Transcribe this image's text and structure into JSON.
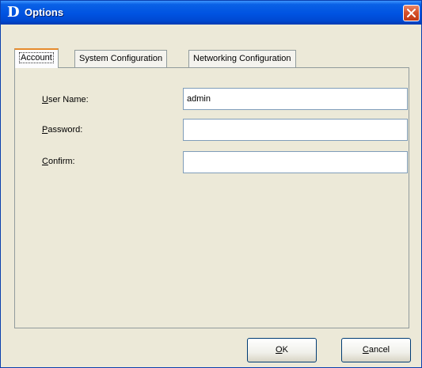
{
  "window": {
    "logo_text": "D",
    "title": "Options",
    "close_icon": "close-icon"
  },
  "tabs": [
    {
      "label": "Account",
      "active": true
    },
    {
      "label": "System Configuration",
      "active": false
    },
    {
      "label": "Networking Configuration",
      "active": false
    }
  ],
  "account": {
    "user_name": {
      "label_first": "U",
      "label_rest": "ser Name:",
      "value": "admin"
    },
    "password": {
      "label_first": "P",
      "label_rest": "assword:",
      "value": ""
    },
    "confirm": {
      "label_first": "C",
      "label_rest": "onfirm:",
      "value": ""
    }
  },
  "buttons": {
    "ok": {
      "label_first": "O",
      "label_rest": "K"
    },
    "cancel": {
      "label_first": "C",
      "label_rest": "ancel"
    }
  },
  "colors": {
    "title_bar": "#0053e1",
    "dialog_bg": "#ece9d8",
    "active_tab_accent": "#e68b2c",
    "close_button": "#d6522c"
  }
}
